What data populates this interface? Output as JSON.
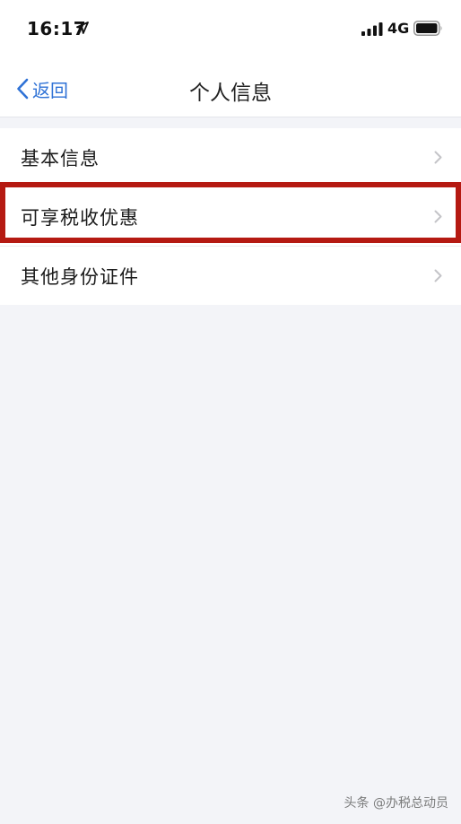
{
  "status_bar": {
    "time": "16:17",
    "network": "4G",
    "icons": [
      "location-arrow-icon",
      "signal-icon",
      "battery-icon"
    ]
  },
  "nav": {
    "back_label": "返回",
    "title": "个人信息",
    "back_icon": "chevron-left-icon"
  },
  "menu": {
    "items": [
      {
        "label": "基本信息",
        "highlighted": false
      },
      {
        "label": "可享税收优惠",
        "highlighted": true
      },
      {
        "label": "其他身份证件",
        "highlighted": false
      }
    ],
    "chevron_icon": "chevron-right-icon"
  },
  "watermark": {
    "text": "头条 @办税总动员"
  },
  "colors": {
    "accent": "#2f72d6",
    "highlight": "#b51a12",
    "background": "#f3f4f8",
    "surface": "#ffffff"
  }
}
